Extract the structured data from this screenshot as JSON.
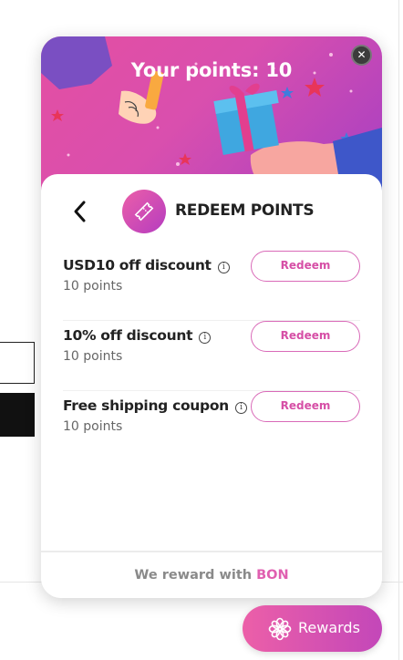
{
  "popup": {
    "points_title": "Your points: 10",
    "close_glyph": "✕",
    "panel_title": "REDEEM POINTS",
    "back_icon": "chevron-left-icon",
    "header_icon": "ticket-icon",
    "rewards": [
      {
        "name": "USD10 off discount",
        "cost": "10 points",
        "button": "Redeem"
      },
      {
        "name": "10% off discount",
        "cost": "10 points",
        "button": "Redeem"
      },
      {
        "name": "Free shipping coupon",
        "cost": "10 points",
        "button": "Redeem"
      }
    ],
    "info_glyph": "i",
    "footer": {
      "prefix": "We reward with ",
      "brand": "BON"
    }
  },
  "launcher": {
    "label": "Rewards",
    "icon": "flower-icon"
  },
  "colors": {
    "accent": "#e05fb0",
    "gradient_start": "#ec5fa8",
    "gradient_end": "#b53cc0"
  }
}
